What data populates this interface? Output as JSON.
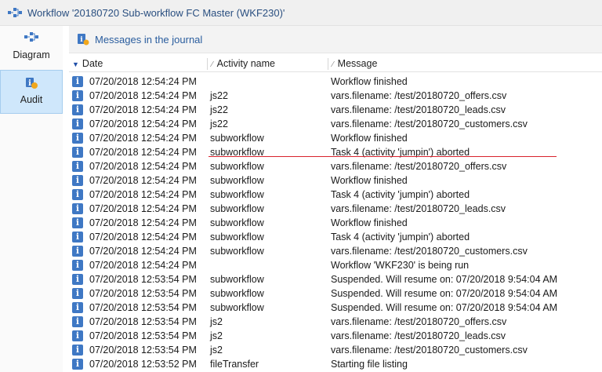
{
  "window": {
    "title": "Workflow '20180720 Sub-workflow FC Master (WKF230)'"
  },
  "sidebar": {
    "items": [
      {
        "label": "Diagram",
        "icon": "diagram-icon",
        "selected": false
      },
      {
        "label": "Audit",
        "icon": "audit-icon",
        "selected": true
      }
    ]
  },
  "panel": {
    "title": "Messages in the journal"
  },
  "table": {
    "columns": [
      {
        "label": "Date",
        "sorted": "descending"
      },
      {
        "label": "Activity name"
      },
      {
        "label": "Message"
      }
    ],
    "rows": [
      {
        "date": "07/20/2018 12:54:24 PM",
        "activity": "",
        "message": "Workflow finished"
      },
      {
        "date": "07/20/2018 12:54:24 PM",
        "activity": "js22",
        "message": "vars.filename: /test/20180720_offers.csv"
      },
      {
        "date": "07/20/2018 12:54:24 PM",
        "activity": "js22",
        "message": "vars.filename: /test/20180720_leads.csv"
      },
      {
        "date": "07/20/2018 12:54:24 PM",
        "activity": "js22",
        "message": "vars.filename: /test/20180720_customers.csv"
      },
      {
        "date": "07/20/2018 12:54:24 PM",
        "activity": "subworkflow",
        "message": "Workflow finished"
      },
      {
        "date": "07/20/2018 12:54:24 PM",
        "activity": "subworkflow",
        "message": "Task 4 (activity 'jumpin') aborted"
      },
      {
        "date": "07/20/2018 12:54:24 PM",
        "activity": "subworkflow",
        "message": "vars.filename: /test/20180720_offers.csv"
      },
      {
        "date": "07/20/2018 12:54:24 PM",
        "activity": "subworkflow",
        "message": "Workflow finished"
      },
      {
        "date": "07/20/2018 12:54:24 PM",
        "activity": "subworkflow",
        "message": "Task 4 (activity 'jumpin') aborted"
      },
      {
        "date": "07/20/2018 12:54:24 PM",
        "activity": "subworkflow",
        "message": "vars.filename: /test/20180720_leads.csv"
      },
      {
        "date": "07/20/2018 12:54:24 PM",
        "activity": "subworkflow",
        "message": "Workflow finished"
      },
      {
        "date": "07/20/2018 12:54:24 PM",
        "activity": "subworkflow",
        "message": "Task 4 (activity 'jumpin') aborted"
      },
      {
        "date": "07/20/2018 12:54:24 PM",
        "activity": "subworkflow",
        "message": "vars.filename: /test/20180720_customers.csv"
      },
      {
        "date": "07/20/2018 12:54:24 PM",
        "activity": "",
        "message": "Workflow 'WKF230' is being run"
      },
      {
        "date": "07/20/2018 12:53:54 PM",
        "activity": "subworkflow",
        "message": "Suspended. Will resume on: 07/20/2018 9:54:04 AM"
      },
      {
        "date": "07/20/2018 12:53:54 PM",
        "activity": "subworkflow",
        "message": "Suspended. Will resume on: 07/20/2018 9:54:04 AM"
      },
      {
        "date": "07/20/2018 12:53:54 PM",
        "activity": "subworkflow",
        "message": "Suspended. Will resume on: 07/20/2018 9:54:04 AM"
      },
      {
        "date": "07/20/2018 12:53:54 PM",
        "activity": "js2",
        "message": "vars.filename: /test/20180720_offers.csv"
      },
      {
        "date": "07/20/2018 12:53:54 PM",
        "activity": "js2",
        "message": "vars.filename: /test/20180720_leads.csv"
      },
      {
        "date": "07/20/2018 12:53:54 PM",
        "activity": "js2",
        "message": "vars.filename: /test/20180720_customers.csv"
      },
      {
        "date": "07/20/2018 12:53:52 PM",
        "activity": "fileTransfer",
        "message": "Starting file listing"
      }
    ]
  },
  "colors": {
    "accent": "#2a5d9e",
    "row_icon": "#3f78c4",
    "selection": "#cfe7fb",
    "annotation_line": "#d9232d"
  }
}
